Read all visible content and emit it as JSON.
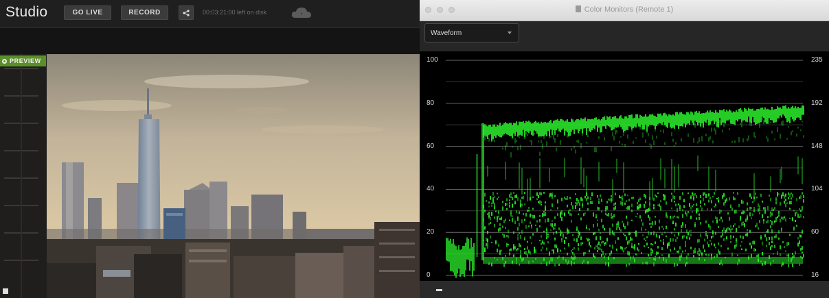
{
  "studio": {
    "title": "Studio",
    "buttons": {
      "go_live": "GO LIVE",
      "record": "RECORD"
    },
    "disk_left": "00:03:21:00 left on disk",
    "preview_label": "PREVIEW",
    "icons": [
      "share-icon",
      "cloud-icon",
      "preview-indicator-icon"
    ]
  },
  "color_monitors": {
    "window_title": "Color Monitors (Remote 1)",
    "mode": "Waveform",
    "scale_left": [
      "100",
      "80",
      "60",
      "40",
      "20",
      "0"
    ],
    "scale_right": [
      "235",
      "192",
      "148",
      "104",
      "60",
      "16"
    ],
    "trace_color": "#2cf02c"
  }
}
